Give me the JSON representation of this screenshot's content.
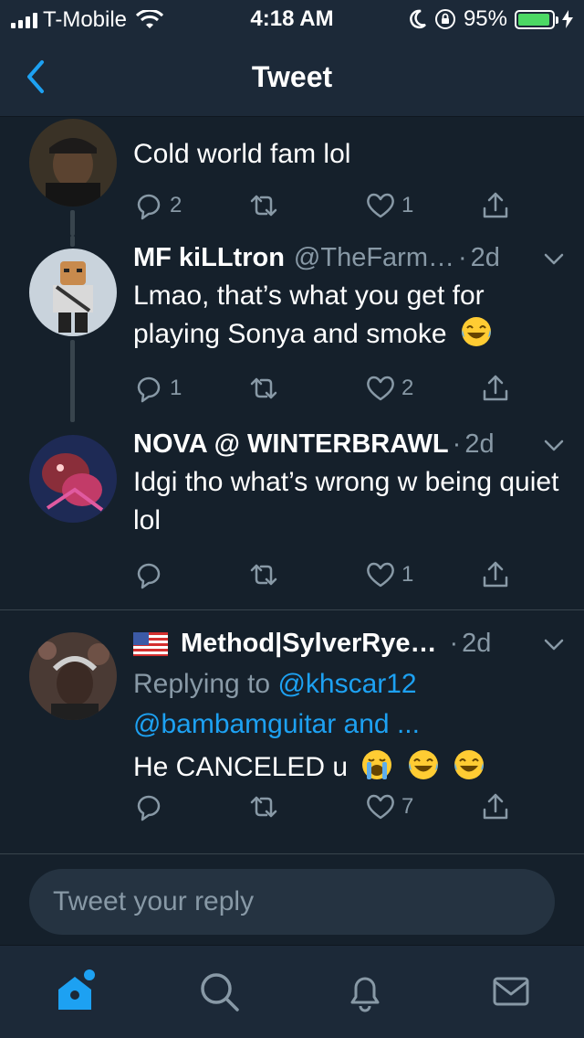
{
  "status_bar": {
    "carrier": "T-Mobile",
    "time": "4:18 AM",
    "battery": "95%",
    "battery_level": 0.95
  },
  "nav": {
    "title": "Tweet",
    "back_icon": "chevron-left-icon"
  },
  "tweets": [
    {
      "body": "Cold world fam lol",
      "replies": "2",
      "retweets": "",
      "likes": "1"
    },
    {
      "name": "MF kiLLtron",
      "handle": "@TheFarm…",
      "time": "2d",
      "body": "Lmao, that’s what you get for playing Sonya and smoke",
      "emoji": [
        "face-with-tears-of-joy"
      ],
      "replies": "1",
      "retweets": "",
      "likes": "2"
    },
    {
      "name": "NOVA @ WINTERBRAWL",
      "time": "2d",
      "body": "Idgi tho what’s wrong w being quiet lol",
      "replies": "",
      "retweets": "",
      "likes": "1"
    },
    {
      "name": "Method|SylverRye…",
      "time": "2d",
      "flag": "us-flag",
      "reply_prefix": "Replying to",
      "reply_link_1": "@khscar12",
      "reply_link_2": "@bambamguitar and ...",
      "body": "He CANCELED u",
      "emoji": [
        "loudly-crying-face",
        "face-with-tears-of-joy",
        "face-with-tears-of-joy"
      ],
      "replies": "",
      "retweets": "",
      "likes": "7"
    }
  ],
  "reply_bar": {
    "placeholder": "Tweet your reply"
  },
  "tab_bar": {
    "items": [
      "home-icon",
      "search-icon",
      "notifications-icon",
      "messages-icon"
    ]
  },
  "colors": {
    "background": "#15202b",
    "bar": "#1c2938",
    "accent": "#1da1f2",
    "muted": "#8899a6"
  }
}
